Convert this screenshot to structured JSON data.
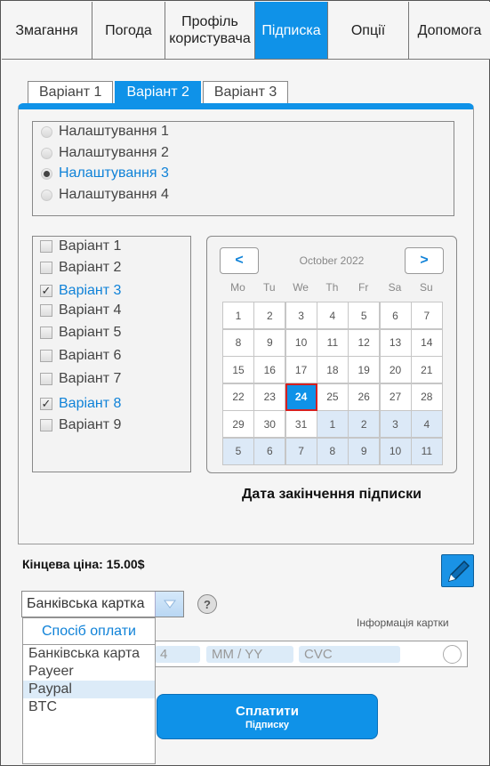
{
  "nav": {
    "tabs": [
      {
        "label": "Змагання"
      },
      {
        "label": "Погода"
      },
      {
        "label": "Профіль користувача"
      },
      {
        "label": "Підписка"
      },
      {
        "label": "Опції"
      },
      {
        "label": "Допомога"
      }
    ],
    "active_index": 3
  },
  "subtabs": {
    "items": [
      "Варіант 1",
      "Варіант 2",
      "Варіант 3"
    ],
    "active_index": 1
  },
  "settings": {
    "items": [
      "Налаштування 1",
      "Налаштування 2",
      "Налаштування 3",
      "Налаштування 4"
    ],
    "selected_index": 2
  },
  "variants": {
    "items": [
      "Варіант 1",
      "Варіант 2",
      "Варіант 3",
      "Варіант 4",
      "Варіант 5",
      "Варіант 6",
      "Варіант 7",
      "Варіант 8",
      "Варіант 9"
    ],
    "checked": [
      2,
      7
    ]
  },
  "calendar": {
    "title": "October 2022",
    "prev": "<",
    "next": ">",
    "weekdays": [
      "Mo",
      "Tu",
      "We",
      "Th",
      "Fr",
      "Sa",
      "Su"
    ],
    "days": [
      [
        1,
        2,
        3,
        4,
        5,
        6,
        7
      ],
      [
        8,
        9,
        10,
        11,
        12,
        13,
        14
      ],
      [
        15,
        16,
        17,
        18,
        19,
        20,
        21
      ],
      [
        22,
        23,
        24,
        25,
        26,
        27,
        28
      ],
      [
        29,
        30,
        31,
        1,
        2,
        3,
        4
      ],
      [
        5,
        6,
        7,
        8,
        9,
        10,
        11
      ]
    ],
    "selected_day": 24,
    "caption": "Дата закінчення підписки"
  },
  "price": {
    "label": "Кінцева ціна: 15.00$"
  },
  "payment": {
    "select_value": "Банківська картка",
    "help": "?",
    "dropdown_header": "Спосіб оплати",
    "options": [
      "Банківська карта",
      "Payeer",
      "Paypal",
      "BTC"
    ],
    "highlighted_index": 2
  },
  "card": {
    "info_label": "Інформація картки",
    "number_placeholder": "4",
    "expiry_placeholder": "MM / YY",
    "cvc_placeholder": "CVC"
  },
  "pay_button": {
    "label": "Сплатити",
    "sublabel": "Підписку"
  },
  "colors": {
    "accent": "#0f92e8",
    "selected_text": "#0f82d8",
    "today_border": "#d62020",
    "other_month": "#dce9f7"
  }
}
